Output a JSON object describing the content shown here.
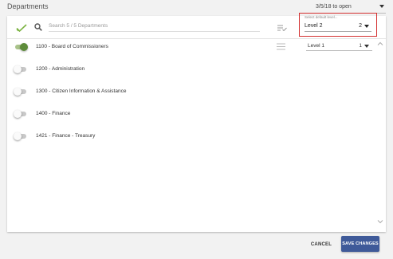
{
  "header": {
    "title": "Departments",
    "date_select_value": "3/5/18 to open"
  },
  "toolbar": {
    "search_placeholder": "Search 5 / 5 Departments",
    "default_level_label": "Select default level...",
    "default_level_name": "Level 2",
    "default_level_number": "2"
  },
  "departments": [
    {
      "label": "1100 - Board of Commissioners",
      "enabled": true,
      "level_name": "Level 1",
      "level_number": "1"
    },
    {
      "label": "1200 - Administration",
      "enabled": false
    },
    {
      "label": "1300 - Citizen Information & Assistance",
      "enabled": false
    },
    {
      "label": "1400 - Finance",
      "enabled": false
    },
    {
      "label": "1421 - Finance - Treasury",
      "enabled": false
    }
  ],
  "footer": {
    "cancel_label": "CANCEL",
    "save_label": "SAVE CHANGES"
  },
  "colors": {
    "accent_button": "#3f5a99",
    "toggle_on": "#5e8c3a",
    "check_icon": "#7cb342",
    "highlight_box": "#d32f2f"
  },
  "icons": [
    "check-all-icon",
    "search-icon",
    "list-check-icon",
    "list-icon",
    "chevron-up-icon",
    "chevron-down-icon"
  ]
}
